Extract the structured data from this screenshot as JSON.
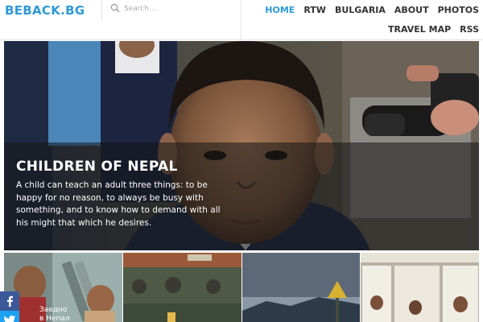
{
  "header": {
    "logo": "BEBACK.BG",
    "search": {
      "placeholder": "Search ..."
    }
  },
  "nav": {
    "items": [
      {
        "label": "HOME",
        "active": true
      },
      {
        "label": "RTW"
      },
      {
        "label": "BULGARIA"
      },
      {
        "label": "ABOUT"
      },
      {
        "label": "PHOTOS"
      },
      {
        "label": "TRAVEL MAP"
      },
      {
        "label": "RSS"
      }
    ]
  },
  "hero": {
    "title": "CHILDREN OF NEPAL",
    "text": "A child can teach an adult three things: to be happy for no reason, to always be busy with something, and to know how to demand with all his might that which he desires."
  },
  "thumbs": [
    {
      "caption_line1": "Заедно",
      "caption_line2": "в Непал"
    },
    {
      "image": "temple-fountain"
    },
    {
      "image": "mountain-sign"
    },
    {
      "image": "photo-wall"
    }
  ],
  "social": {
    "facebook_icon": "facebook-icon",
    "twitter_icon": "twitter-icon"
  },
  "colors": {
    "accent": "#2d9ad6",
    "facebook": "#3b5998",
    "twitter": "#1da1f2"
  }
}
